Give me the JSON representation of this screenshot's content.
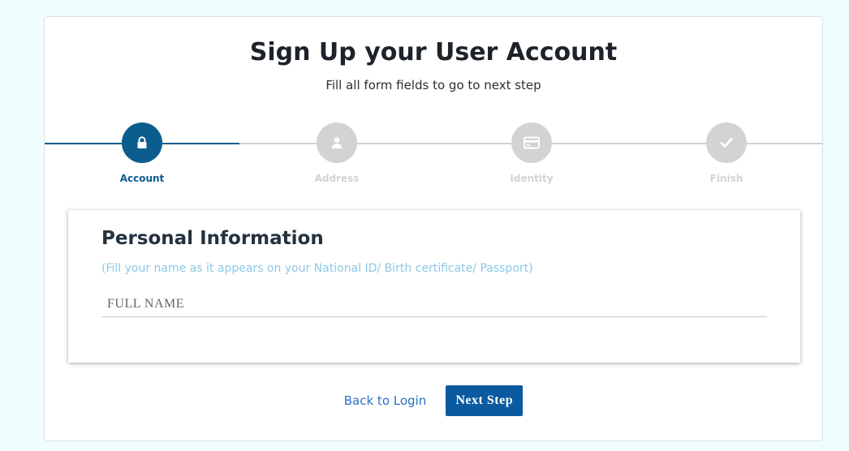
{
  "header": {
    "title": "Sign Up your User Account",
    "subtitle": "Fill all form fields to go to next step"
  },
  "steps": [
    {
      "label": "Account",
      "icon": "lock-icon",
      "active": true
    },
    {
      "label": "Address",
      "icon": "user-icon",
      "active": false
    },
    {
      "label": "Identity",
      "icon": "credit-card-icon",
      "active": false
    },
    {
      "label": "Finish",
      "icon": "check-icon",
      "active": false
    }
  ],
  "form": {
    "section_title": "Personal Information",
    "hint": "(Fill your name as it appears on your National ID/ Birth certificate/ Passport)",
    "full_name": {
      "placeholder": "FULL NAME",
      "value": ""
    }
  },
  "actions": {
    "back_label": "Back to Login",
    "next_label": "Next Step"
  },
  "colors": {
    "accent": "#0b5d8e",
    "inactive": "#d3d3d3",
    "hint": "#8dc8e6",
    "button": "#0b5aa0",
    "link": "#2d6fbf"
  }
}
